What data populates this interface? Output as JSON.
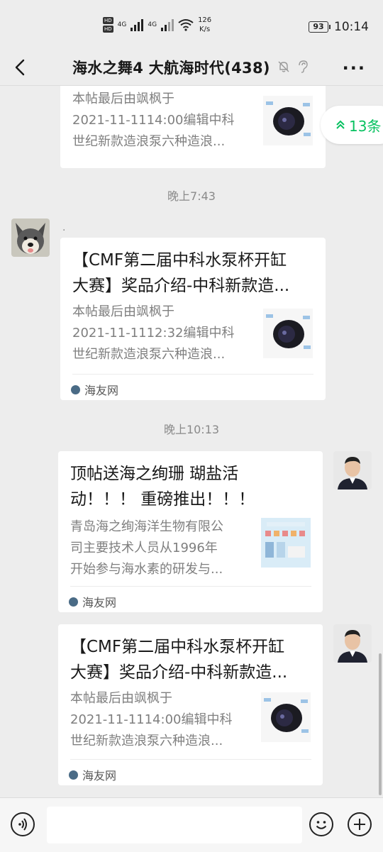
{
  "status_bar": {
    "net_speed_value": "126",
    "net_speed_unit": "K/s",
    "battery": "93",
    "time": "10:14",
    "net1": "4G",
    "net2": "4G",
    "hd1": "HD",
    "hd2": "HD"
  },
  "header": {
    "title": "海水之舞4 大航海时代(438)"
  },
  "new_messages": {
    "label": "13条"
  },
  "messages": [
    {
      "desc_lines": [
        "本帖最后由飒枫于",
        "2021-11-1114:00编辑中科",
        "世纪新款造浪泵六种造浪..."
      ]
    },
    {
      "time": "晚上7:43"
    },
    {
      "sender_name": ".",
      "title_lines": [
        "【CMF第二届中科水泵杯开缸",
        "大赛】奖品介绍-中科新款造..."
      ],
      "desc_lines": [
        "本帖最后由飒枫于",
        "2021-11-1112:32编辑中科",
        "世纪新款造浪泵六种造浪..."
      ],
      "source": "海友网"
    },
    {
      "time": "晚上10:13"
    },
    {
      "title_lines": [
        "顶帖送海之绚珊 瑚盐活",
        "动！！！ 重磅推出！！！"
      ],
      "desc_lines": [
        "青岛海之绚海洋生物有限公",
        "司主要技术人员从1996年",
        "开始参与海水素的研发与..."
      ],
      "source": "海友网"
    },
    {
      "title_lines": [
        "【CMF第二届中科水泵杯开缸",
        "大赛】奖品介绍-中科新款造..."
      ],
      "desc_lines": [
        "本帖最后由飒枫于",
        "2021-11-1114:00编辑中科",
        "世纪新款造浪泵六种造浪..."
      ],
      "source": "海友网"
    }
  ],
  "colors": {
    "background": "#ededed",
    "card": "#ffffff",
    "accent_green": "#07c160",
    "desc_gray": "#7f7f7f"
  },
  "icons": [
    "back-arrow-icon",
    "bell-off-icon",
    "ear-icon",
    "more-icon",
    "double-chevron-up-icon",
    "voice-icon",
    "emoji-icon",
    "plus-icon",
    "source-logo-icon"
  ]
}
